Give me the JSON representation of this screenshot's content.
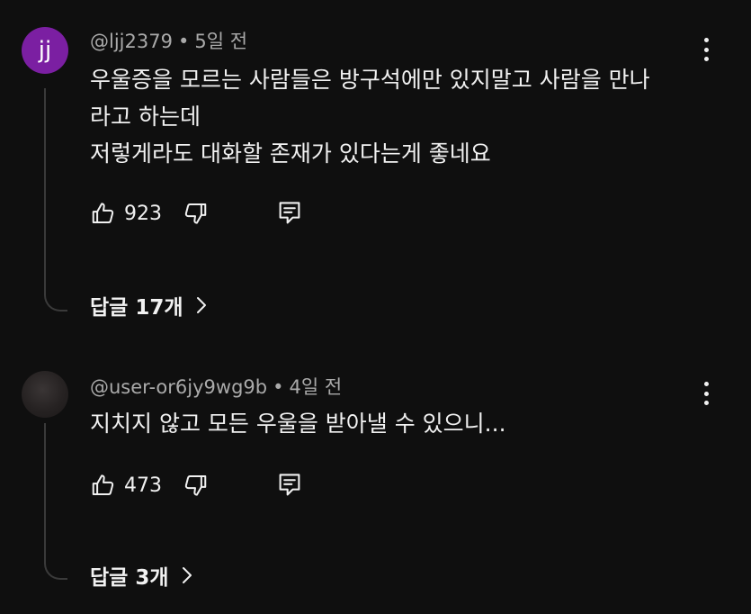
{
  "comments": [
    {
      "avatar_text": "jj",
      "avatar_color": "#7b1fa2",
      "author": "@ljj2379",
      "separator": "•",
      "time": "5일 전",
      "lines": [
        "우울증을 모르는 사람들은 방구석에만 있지말고 사람을 만나",
        "라고 하는데",
        "저렇게라도 대화할 존재가 있다는게 좋네요"
      ],
      "likes": "923",
      "replies_label": "답글 17개"
    },
    {
      "avatar_text": "",
      "avatar_color": "#2a2626",
      "author": "@user-or6jy9wg9b",
      "separator": "•",
      "time": "4일 전",
      "lines": [
        "지치지 않고 모든 우울을 받아낼 수 있으니..."
      ],
      "likes": "473",
      "replies_label": "답글 3개"
    }
  ],
  "icons": {
    "like": "thumb-up-icon",
    "dislike": "thumb-down-icon",
    "reply": "reply-comment-icon",
    "more": "more-vertical-icon",
    "chevron": "chevron-right-icon"
  },
  "colors": {
    "background": "#0f0f0f",
    "text_primary": "#f1f1f1",
    "text_secondary": "#aaaaaa"
  }
}
